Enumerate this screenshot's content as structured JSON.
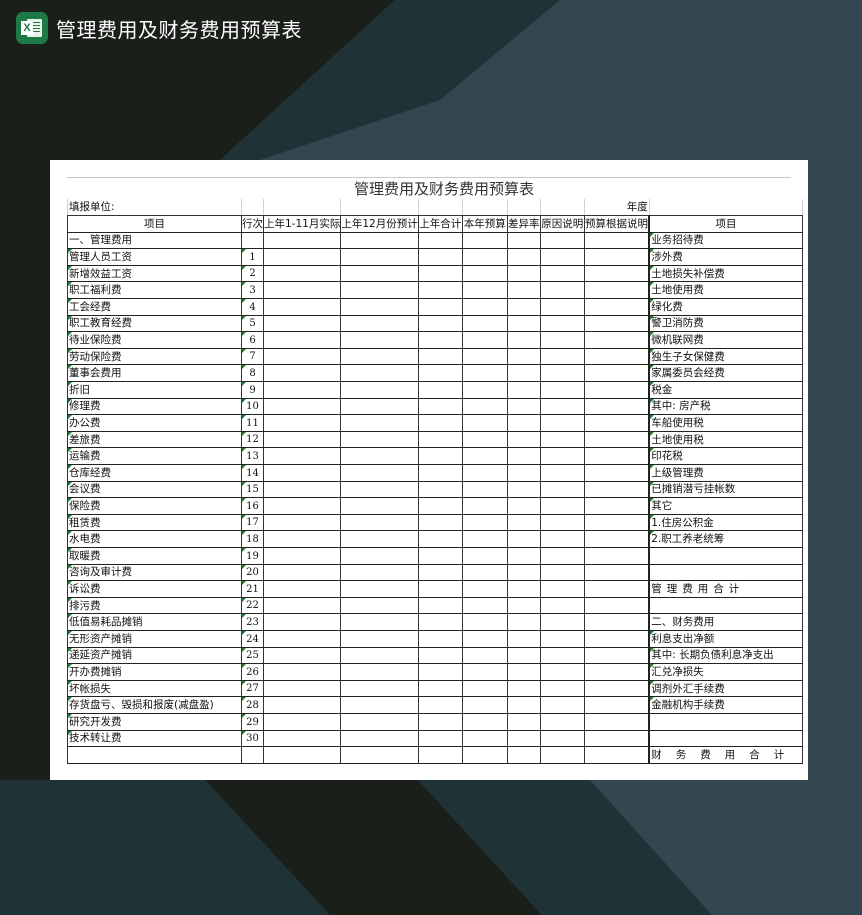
{
  "app": {
    "title": "管理费用及财务费用预算表",
    "icon": "excel-icon",
    "icon_letter": "X"
  },
  "colors": {
    "background": "#34464f",
    "stripe_dark": "#1b1f1a",
    "stripe_mid": "#1f3236",
    "app_icon": "#1d7a45",
    "cell_marker": "#1e7b34"
  },
  "document": {
    "title": "管理费用及财务费用预算表",
    "fill_unit_label": "填报单位:",
    "year_label": "年度",
    "headers": [
      "项目",
      "行次",
      "上年1-11月实际",
      "上年12月份预计",
      "上年合计",
      "本年预算",
      "差异率",
      "原因说明",
      "预算根据说明",
      "项目"
    ],
    "section1": "一、管理费用",
    "left_items": [
      {
        "name": "管理人员工资",
        "line": "1"
      },
      {
        "name": "新增效益工资",
        "line": "2"
      },
      {
        "name": "职工福利费",
        "line": "3"
      },
      {
        "name": "工会经费",
        "line": "4"
      },
      {
        "name": "职工教育经费",
        "line": "5"
      },
      {
        "name": "待业保险费",
        "line": "6"
      },
      {
        "name": "劳动保险费",
        "line": "7"
      },
      {
        "name": "董事会费用",
        "line": "8"
      },
      {
        "name": "折旧",
        "line": "9"
      },
      {
        "name": "修理费",
        "line": "10"
      },
      {
        "name": "办公费",
        "line": "11"
      },
      {
        "name": "差旅费",
        "line": "12"
      },
      {
        "name": "运输费",
        "line": "13"
      },
      {
        "name": "仓库经费",
        "line": "14"
      },
      {
        "name": "会议费",
        "line": "15"
      },
      {
        "name": "保险费",
        "line": "16"
      },
      {
        "name": "租赁费",
        "line": "17"
      },
      {
        "name": "水电费",
        "line": "18"
      },
      {
        "name": "取暖费",
        "line": "19"
      },
      {
        "name": "咨询及审计费",
        "line": "20"
      },
      {
        "name": "诉讼费",
        "line": "21"
      },
      {
        "name": "排污费",
        "line": "22"
      },
      {
        "name": "低值易耗品摊销",
        "line": "23"
      },
      {
        "name": "无形资产摊销",
        "line": "24"
      },
      {
        "name": "递延资产摊销",
        "line": "25"
      },
      {
        "name": "开办费摊销",
        "line": "26"
      },
      {
        "name": "坏帐损失",
        "line": "27"
      },
      {
        "name": "存货盘亏、毁损和报废(减盘盈)",
        "line": "28"
      },
      {
        "name": "研究开发费",
        "line": "29"
      },
      {
        "name": "技术转让费",
        "line": "30"
      }
    ],
    "right_items": [
      "业务招待费",
      "涉外费",
      "土地损失补偿费",
      "土地使用费",
      "绿化费",
      "警卫消防费",
      "微机联网费",
      "独生子女保健费",
      "家属委员会经费",
      "税金",
      "其中:  房产税",
      "车船使用税",
      "土地使用税",
      "印花税",
      "上级管理费",
      "已摊销潜亏挂帐数",
      "其它",
      "1.住房公积金",
      "2.职工养老统筹",
      "",
      "",
      "管理费用合计",
      "",
      "二、财务费用",
      "利息支出净额",
      "其中:  长期负债利息净支出",
      "汇兑净损失",
      "调剂外汇手续费",
      "金融机构手续费",
      "",
      "",
      "财务费用合计"
    ]
  }
}
